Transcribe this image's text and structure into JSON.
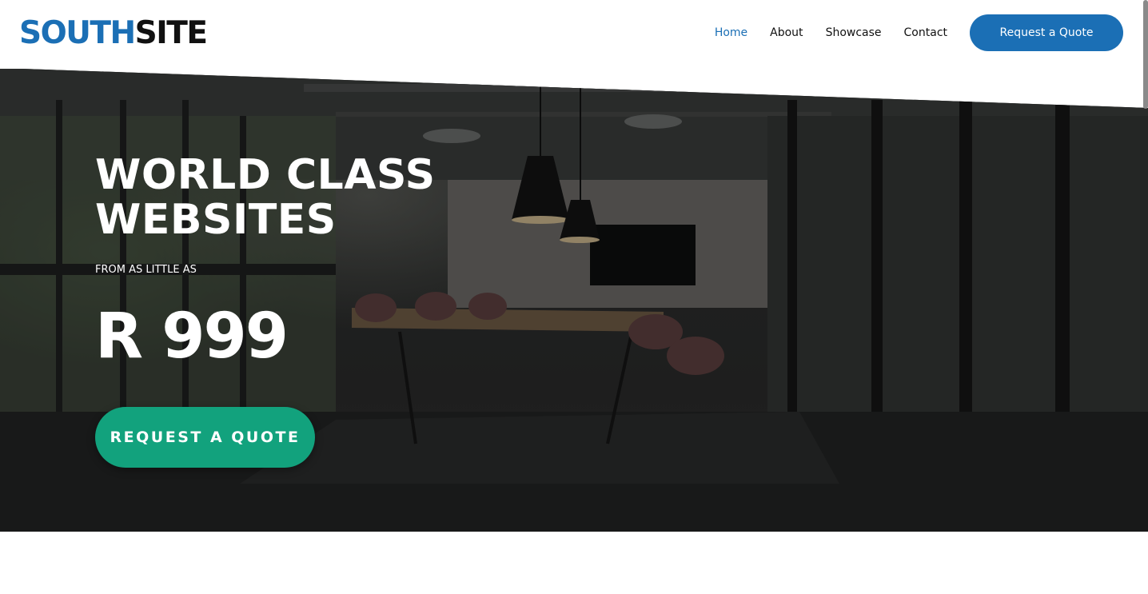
{
  "brand": {
    "part1": "SOUTH",
    "part2": "SITE",
    "primary_color": "#1b6fb5",
    "text_color": "#111111"
  },
  "nav": {
    "items": [
      {
        "label": "Home",
        "active": true
      },
      {
        "label": "About",
        "active": false
      },
      {
        "label": "Showcase",
        "active": false
      },
      {
        "label": "Contact",
        "active": false
      }
    ],
    "cta_label": "Request a Quote"
  },
  "hero": {
    "title_line1": "WORLD CLASS",
    "title_line2": "WEBSITES",
    "subtitle": "FROM AS LITTLE AS",
    "price": "R 999",
    "cta_label": "REQUEST A QUOTE",
    "cta_color": "#12a27d",
    "background_image": "dark office conference room with table, chairs and pendant lamps"
  }
}
